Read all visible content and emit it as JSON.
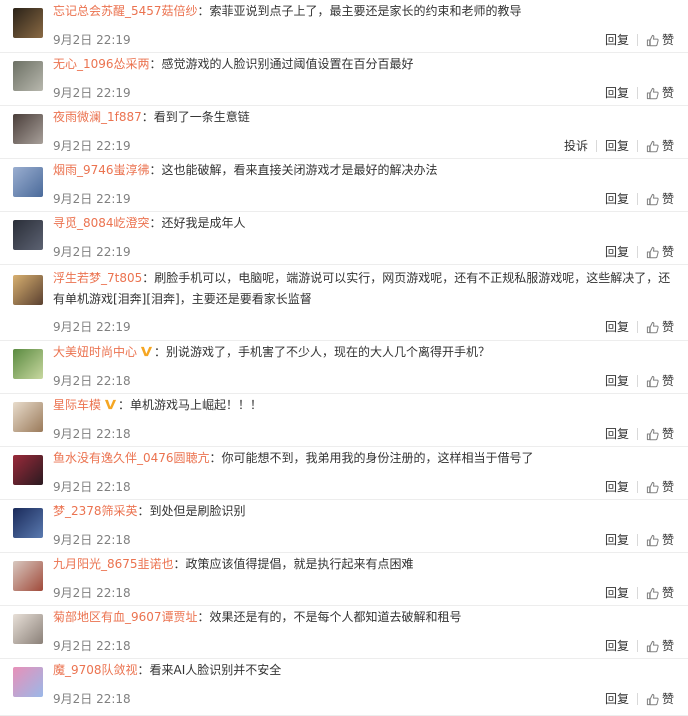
{
  "comments": [
    {
      "user": "忘记总会苏醒_5457菇倍纱",
      "vip": false,
      "text": "：索菲亚说到点子上了，最主要还是家长的约束和老师的教导",
      "time": "9月2日 22:19",
      "reply": "回复",
      "like": "赞",
      "report": null,
      "avatar_colors": [
        "#2a2218",
        "#8a6a44"
      ]
    },
    {
      "user": "无心_1096怂采两",
      "vip": false,
      "text": "：感觉游戏的人脸识别通过阈值设置在百分百最好",
      "time": "9月2日 22:19",
      "reply": "回复",
      "like": "赞",
      "report": null,
      "avatar_colors": [
        "#6c7064",
        "#b8b8ae"
      ]
    },
    {
      "user": "夜雨微澜_1f887",
      "vip": false,
      "text": "：看到了一条生意链",
      "time": "9月2日 22:19",
      "reply": "回复",
      "like": "赞",
      "report": "投诉",
      "avatar_colors": [
        "#4a3e3a",
        "#a8a09a"
      ]
    },
    {
      "user": "烟雨_9746蚩淳彿",
      "vip": false,
      "text": "：这也能破解，看来直接关闭游戏才是最好的解决办法",
      "time": "9月2日 22:19",
      "reply": "回复",
      "like": "赞",
      "report": null,
      "avatar_colors": [
        "#9aaed0",
        "#4a6a9a"
      ]
    },
    {
      "user": "寻觅_8084屹澄突",
      "vip": false,
      "text": "：还好我是成年人",
      "time": "9月2日 22:19",
      "reply": "回复",
      "like": "赞",
      "report": null,
      "avatar_colors": [
        "#2a2e38",
        "#5c6272"
      ]
    },
    {
      "user": "浮生若梦_7t805",
      "vip": false,
      "text": "：刷脸手机可以，电脑呢，端游说可以实行，网页游戏呢，还有不正规私服游戏呢，这些解决了，还有单机游戏[泪奔][泪奔]，主要还是要看家长监督",
      "time": "9月2日 22:19",
      "reply": "回复",
      "like": "赞",
      "report": null,
      "avatar_colors": [
        "#d8b070",
        "#5a4030"
      ]
    },
    {
      "user": "大美妞时尚中心",
      "vip": true,
      "text": "：别说游戏了，手机害了不少人，现在的大人几个离得开手机？",
      "time": "9月2日 22:18",
      "reply": "回复",
      "like": "赞",
      "report": null,
      "avatar_colors": [
        "#5a8a40",
        "#c8d8a0"
      ]
    },
    {
      "user": "星际车模",
      "vip": true,
      "text": "：单机游戏马上崛起！！！",
      "time": "9月2日 22:18",
      "reply": "回复",
      "like": "赞",
      "report": null,
      "avatar_colors": [
        "#e8dccc",
        "#9a7a5a"
      ]
    },
    {
      "user": "鱼水没有逸久伴_0476圆聴亢",
      "vip": false,
      "text": "：你可能想不到，我弟用我的身份注册的，这样相当于借号了",
      "time": "9月2日 22:18",
      "reply": "回复",
      "like": "赞",
      "report": null,
      "avatar_colors": [
        "#9a2a3a",
        "#2a1a20"
      ]
    },
    {
      "user": "梦_2378筛采英",
      "vip": false,
      "text": "：到处但是刷脸识别",
      "time": "9月2日 22:18",
      "reply": "回复",
      "like": "赞",
      "report": null,
      "avatar_colors": [
        "#1a2a5a",
        "#5a7ab0"
      ]
    },
    {
      "user": "九月阳光_8675韭诺也",
      "vip": false,
      "text": "：政策应该值得提倡，就是执行起来有点困难",
      "time": "9月2日 22:18",
      "reply": "回复",
      "like": "赞",
      "report": null,
      "avatar_colors": [
        "#d8c8c0",
        "#a04a3a"
      ]
    },
    {
      "user": "菊部地区有血_9607谭贾址",
      "vip": false,
      "text": "：效果还是有的，不是每个人都知道去破解和租号",
      "time": "9月2日 22:18",
      "reply": "回复",
      "like": "赞",
      "report": null,
      "avatar_colors": [
        "#e8e0d8",
        "#8a8078"
      ]
    },
    {
      "user": "魔_9708队敛视",
      "vip": false,
      "text": "：看来AI人脸识别并不安全",
      "time": "9月2日 22:18",
      "reply": "回复",
      "like": "赞",
      "report": null,
      "avatar_colors": [
        "#e890b8",
        "#9ab8e8"
      ]
    }
  ]
}
